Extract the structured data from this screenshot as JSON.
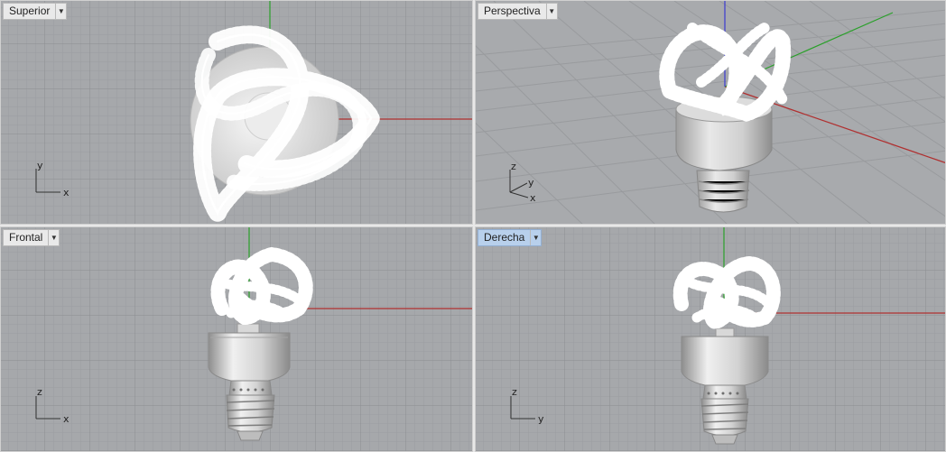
{
  "viewports": [
    {
      "id": "top",
      "label": "Superior",
      "active": false,
      "axis_h": "x",
      "axis_v": "y"
    },
    {
      "id": "perspective",
      "label": "Perspectiva",
      "active": false,
      "axis_1": "z",
      "axis_2": "y",
      "axis_3": "x"
    },
    {
      "id": "front",
      "label": "Frontal",
      "active": false,
      "axis_h": "x",
      "axis_v": "z"
    },
    {
      "id": "right",
      "label": "Derecha",
      "active": true,
      "axis_h": "y",
      "axis_v": "z"
    }
  ],
  "icons": {
    "dropdown": "triangle-down-icon"
  },
  "colors": {
    "background": "#a6a8ab",
    "grid_minor": "#9a9c9f",
    "grid_major": "#8b8d90",
    "x_axis": "#b03030",
    "y_axis": "#2aa02a",
    "z_axis": "#3a3ad0",
    "model": "#f4f4f4",
    "active_tab": "#b8d0ec"
  }
}
